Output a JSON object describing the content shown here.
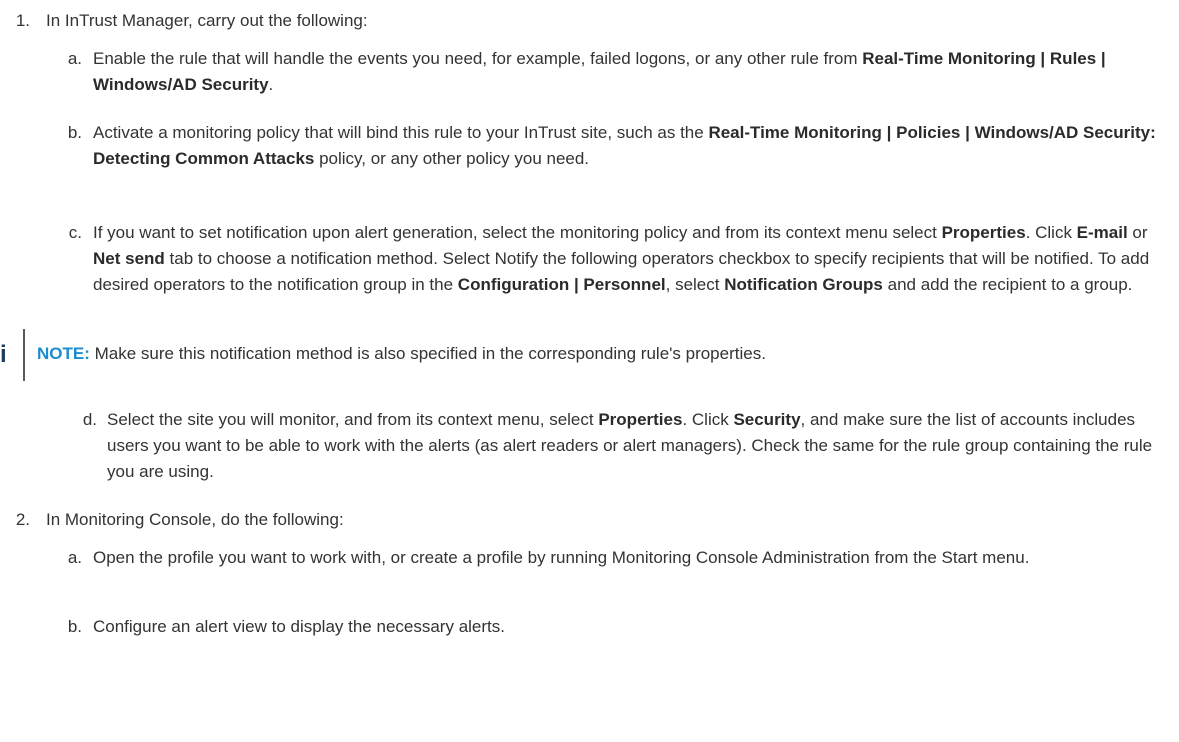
{
  "step1": {
    "number": "1.",
    "intro": "In InTrust Manager, carry out the following:",
    "a": {
      "letter": "a.",
      "text1": "Enable the rule that will handle the events you need, for example, failed logons, or any other rule from ",
      "bold1": "Real-Time Monitoring | Rules | Windows/AD Security",
      "text2": "."
    },
    "b": {
      "letter": "b.",
      "text1": "Activate a monitoring policy that will bind this rule to your InTrust site, such as the ",
      "bold1": "Real-Time Monitoring | Policies | Windows/AD Security: Detecting Common Attacks",
      "text2": " policy, or any other policy you need."
    },
    "c": {
      "letter": "c.",
      "text1": "If you want to set notification upon alert generation, select the monitoring policy and from its context menu select ",
      "bold1": "Properties",
      "text2": ". Click ",
      "bold2": "E-mail",
      "text3": " or ",
      "bold3": "Net send",
      "text4": " tab to choose a notification method. Select Notify the following operators checkbox to specify recipients that will be notified. To add desired operators to the notification group in the ",
      "bold4": "Configuration | Personnel",
      "text5": ", select ",
      "bold5": "Notification Groups",
      "text6": " and add the recipient to a group."
    },
    "note": {
      "icon": "i",
      "label": "NOTE:",
      "text": " Make sure this notification method is also specified in the corresponding rule's properties."
    },
    "d": {
      "letter": "d.",
      "text1": "Select the site you will monitor, and from its context menu, select ",
      "bold1": "Properties",
      "text2": ". Click ",
      "bold2": "Security",
      "text3": ", and make sure the list of accounts includes users you want to be able to work with the alerts (as alert readers or alert managers). Check the same for the rule group containing the rule you are using."
    }
  },
  "step2": {
    "number": "2.",
    "intro": "In Monitoring Console, do the following:",
    "a": {
      "letter": "a.",
      "text": "Open the profile you want to work with, or create a profile by running Monitoring Console Administration from the Start menu."
    },
    "b": {
      "letter": "b.",
      "text": "Configure an alert view to display the necessary alerts."
    }
  }
}
